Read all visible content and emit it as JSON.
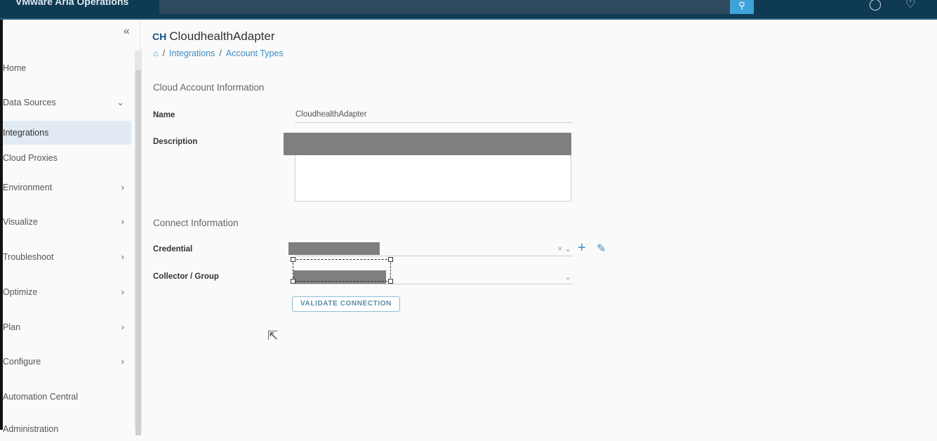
{
  "header": {
    "app_title": "VMware Aria Operations",
    "search_icon": "search-icon"
  },
  "sidebar": {
    "items": [
      {
        "label": "Home"
      },
      {
        "label": "Data Sources",
        "chevron": "v"
      },
      {
        "label": "Integrations"
      },
      {
        "label": "Cloud Proxies"
      },
      {
        "label": "Environment",
        "chevron": ">"
      },
      {
        "label": "Visualize",
        "chevron": ">"
      },
      {
        "label": "Troubleshoot",
        "chevron": ">"
      },
      {
        "label": "Optimize",
        "chevron": ">"
      },
      {
        "label": "Plan",
        "chevron": ">"
      },
      {
        "label": "Configure",
        "chevron": ">"
      },
      {
        "label": "Automation Central"
      },
      {
        "label": "Administration"
      }
    ]
  },
  "page": {
    "logo": "CH",
    "title": "CloudhealthAdapter",
    "breadcrumb": [
      "Integrations",
      "Account Types"
    ],
    "cloud_section": "Cloud Account Information",
    "name_label": "Name",
    "name_value": "CloudhealthAdapter",
    "description_label": "Description",
    "connect_section": "Connect Information",
    "credential_label": "Credential",
    "collector_label": "Collector / Group",
    "validate_label": "VALIDATE CONNECTION"
  }
}
